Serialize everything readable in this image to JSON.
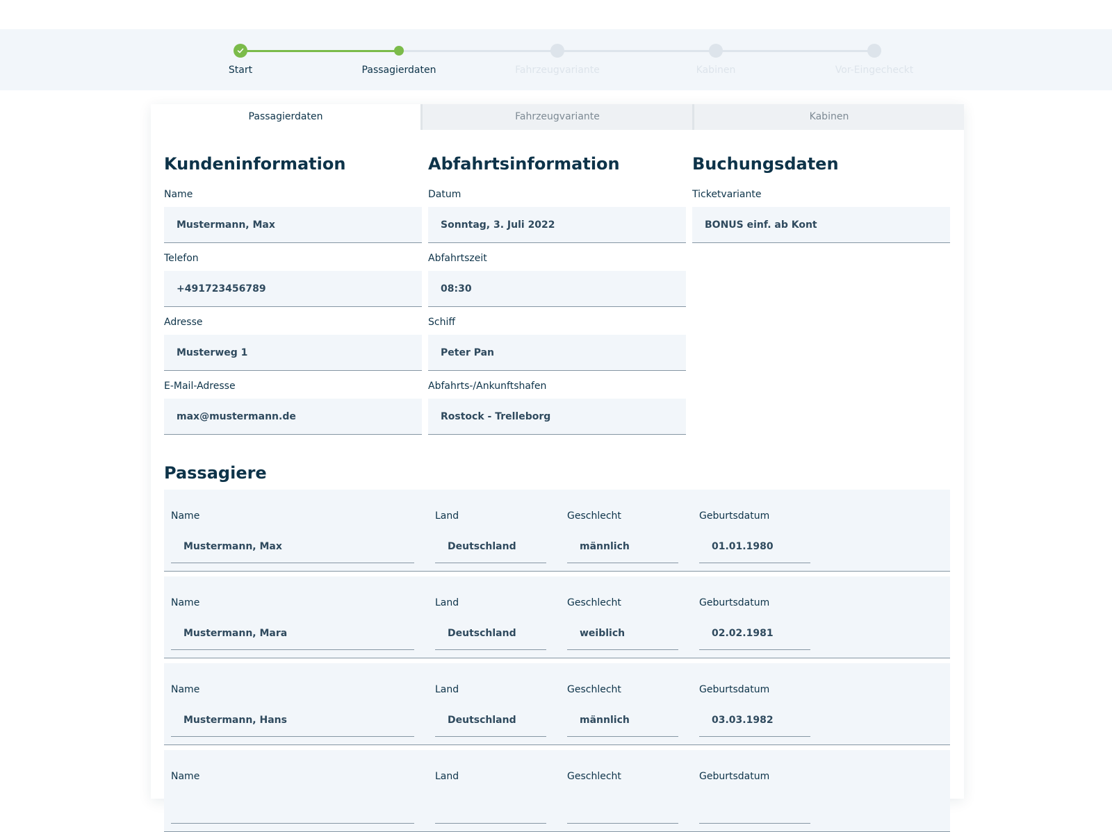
{
  "stepper": {
    "steps": [
      {
        "label": "Start",
        "state": "done"
      },
      {
        "label": "Passagierdaten",
        "state": "active"
      },
      {
        "label": "Fahrzeugvariante",
        "state": "pending"
      },
      {
        "label": "Kabinen",
        "state": "pending"
      },
      {
        "label": "Vor-Eingecheckt",
        "state": "pending"
      }
    ],
    "colors": {
      "done": "#7bbb4a",
      "pending": "#dde4eb"
    }
  },
  "tabs": [
    {
      "label": "Passagierdaten",
      "active": true
    },
    {
      "label": "Fahrzeugvariante",
      "active": false
    },
    {
      "label": "Kabinen",
      "active": false
    }
  ],
  "customer": {
    "title": "Kundeninformation",
    "fields": [
      {
        "label": "Name",
        "value": "Mustermann, Max"
      },
      {
        "label": "Telefon",
        "value": "+491723456789"
      },
      {
        "label": "Adresse",
        "value": "Musterweg 1"
      },
      {
        "label": "E-Mail-Adresse",
        "value": "max@mustermann.de"
      }
    ]
  },
  "departure": {
    "title": "Abfahrtsinformation",
    "fields": [
      {
        "label": "Datum",
        "value": "Sonntag, 3. Juli 2022"
      },
      {
        "label": "Abfahrtszeit",
        "value": "08:30"
      },
      {
        "label": "Schiff",
        "value": "Peter Pan"
      },
      {
        "label": "Abfahrts-/Ankunftshafen",
        "value": "Rostock - Trelleborg"
      }
    ]
  },
  "booking": {
    "title": "Buchungsdaten",
    "fields": [
      {
        "label": "Ticketvariante",
        "value": "BONUS einf. ab Kont"
      }
    ]
  },
  "passengers": {
    "title": "Passagiere",
    "labels": {
      "name": "Name",
      "country": "Land",
      "gender": "Geschlecht",
      "birthdate": "Geburtsdatum"
    },
    "rows": [
      {
        "name": "Mustermann, Max",
        "country": "Deutschland",
        "gender": "männlich",
        "birthdate": "01.01.1980"
      },
      {
        "name": "Mustermann, Mara",
        "country": "Deutschland",
        "gender": "weiblich",
        "birthdate": "02.02.1981"
      },
      {
        "name": "Mustermann, Hans",
        "country": "Deutschland",
        "gender": "männlich",
        "birthdate": "03.03.1982"
      },
      {
        "name": "",
        "country": "",
        "gender": "",
        "birthdate": ""
      }
    ]
  }
}
